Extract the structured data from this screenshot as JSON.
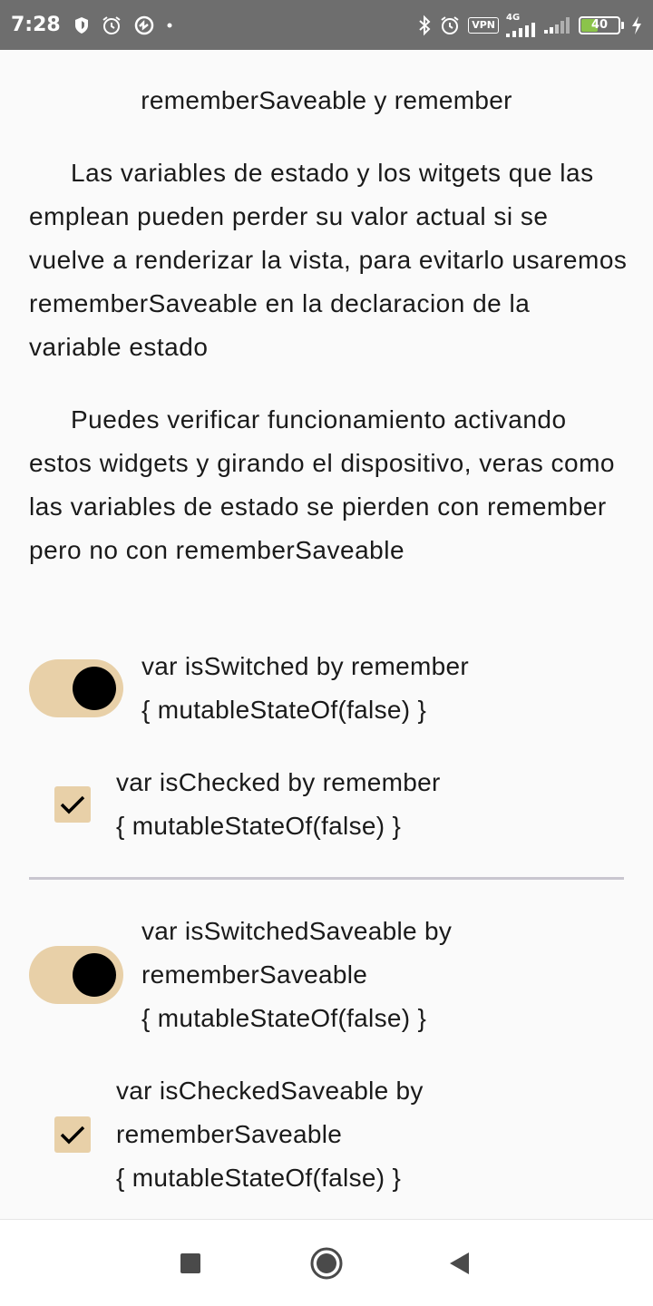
{
  "status_bar": {
    "time": "7:28",
    "network_label": "4G",
    "vpn_label": "VPN",
    "battery_level": "40",
    "icons": [
      "shield-icon",
      "alarm-icon",
      "sync-icon",
      "dot-icon",
      "bluetooth-icon",
      "alarm-clock-icon",
      "vpn-icon",
      "signal-icon",
      "signal-weak-icon",
      "battery-icon",
      "charging-icon"
    ]
  },
  "title": "rememberSaveable y remember",
  "paragraphs": [
    "Las variables de estado y los witgets que las emplean pueden perder su valor actual si se vuelve a renderizar la vista, para evitarlo usaremos rememberSaveable en la declaracion de la variable estado",
    "Puedes verificar funcionamiento activando estos widgets y girando el dispositivo, veras como las variables de estado se pierden con remember pero no con rememberSaveable"
  ],
  "remember_section": {
    "switch_label": [
      "var isSwitched by remember",
      "{ mutableStateOf(false) }"
    ],
    "switch_checked": true,
    "checkbox_label": [
      "var isChecked by remember",
      "{ mutableStateOf(false) }"
    ],
    "checkbox_checked": true
  },
  "saveable_section": {
    "switch_label": [
      "var isSwitchedSaveable by",
      "rememberSaveable",
      "{ mutableStateOf(false) }"
    ],
    "switch_checked": true,
    "checkbox_label": [
      "var isCheckedSaveable by",
      "rememberSaveable",
      "{ mutableStateOf(false) }"
    ],
    "checkbox_checked": true
  },
  "colors": {
    "status_bar": "#6E6E6E",
    "background": "#FAFAFA",
    "control_track": "#E8D0A8",
    "thumb": "#000000",
    "divider": "#C9C6CF",
    "battery_fill": "#8BC34A"
  },
  "nav_bar": {
    "buttons": [
      "recents-square-icon",
      "home-circle-icon",
      "back-triangle-icon"
    ]
  }
}
